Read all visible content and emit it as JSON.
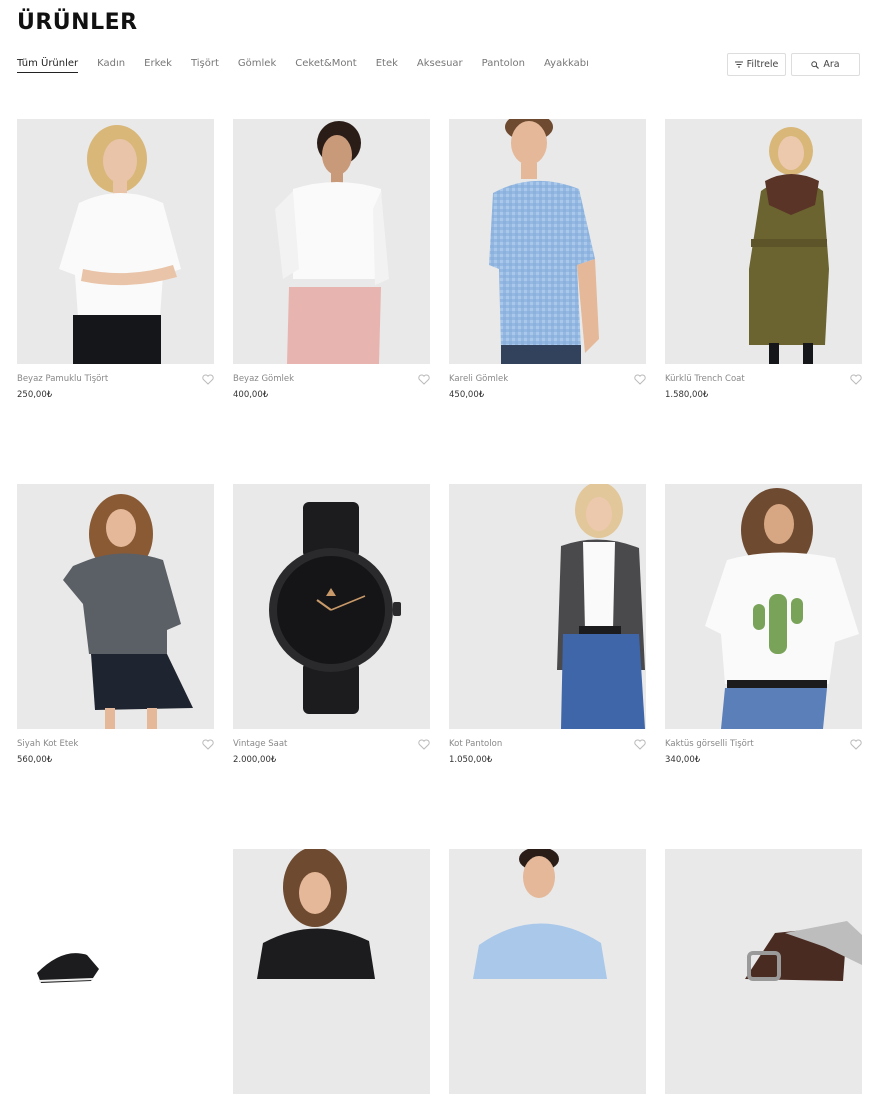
{
  "page": {
    "title": "ÜRÜNLER"
  },
  "nav": {
    "tabs": [
      {
        "label": "Tüm Ürünler",
        "active": true
      },
      {
        "label": "Kadın"
      },
      {
        "label": "Erkek"
      },
      {
        "label": "Tişört"
      },
      {
        "label": "Gömlek"
      },
      {
        "label": "Ceket&Mont"
      },
      {
        "label": "Etek"
      },
      {
        "label": "Aksesuar"
      },
      {
        "label": "Pantolon"
      },
      {
        "label": "Ayakkabı"
      }
    ]
  },
  "toolbar": {
    "filter_label": "Filtrele",
    "search_label": "Ara"
  },
  "products": [
    {
      "name": "Beyaz Pamuklu Tişört",
      "price": "250,00₺",
      "icon": "photo-white-tshirt"
    },
    {
      "name": "Beyaz Gömlek",
      "price": "400,00₺",
      "icon": "photo-white-shirt"
    },
    {
      "name": "Kareli Gömlek",
      "price": "450,00₺",
      "icon": "photo-checked-shirt"
    },
    {
      "name": "Kürklü Trench Coat",
      "price": "1.580,00₺",
      "icon": "photo-trench-coat"
    },
    {
      "name": "Siyah Kot Etek",
      "price": "560,00₺",
      "icon": "photo-denim-skirt"
    },
    {
      "name": "Vintage Saat",
      "price": "2.000,00₺",
      "icon": "photo-watch"
    },
    {
      "name": "Kot Pantolon",
      "price": "1.050,00₺",
      "icon": "photo-jeans"
    },
    {
      "name": "Kaktüs görselli Tişört",
      "price": "340,00₺",
      "icon": "photo-cactus-tshirt"
    },
    {
      "name": "",
      "price": "",
      "icon": "photo-shoe"
    },
    {
      "name": "",
      "price": "",
      "icon": "photo-black-top"
    },
    {
      "name": "",
      "price": "",
      "icon": "photo-blue-shirt"
    },
    {
      "name": "",
      "price": "",
      "icon": "photo-belt"
    }
  ],
  "colors": {
    "heart": "#bbbbbb",
    "image_bg": "#e9e9e9",
    "skin": "#e9c4a8",
    "white_garment": "#fafafa",
    "pink": "#e8b4b0",
    "checked_blue": "#8fb6e0",
    "olive": "#6b6330",
    "fur": "#5a3426",
    "denim_dark": "#1f2530",
    "grey_shirt": "#5b5f66",
    "watch_black": "#1c1c1e",
    "jeans_blue": "#3f66a8",
    "cactus_green": "#7aa35a",
    "hair_blonde": "#d8b779",
    "hair_dark": "#2a1d17",
    "hair_brown": "#6e4a30"
  }
}
